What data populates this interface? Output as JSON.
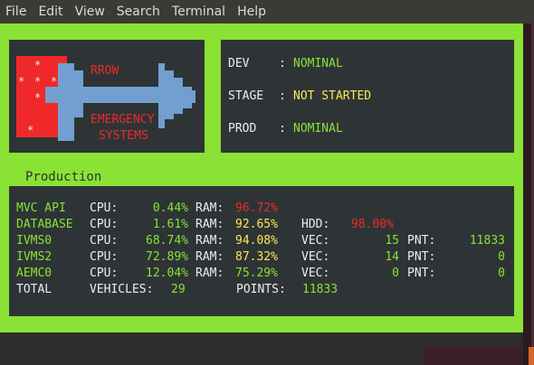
{
  "menu": [
    "File",
    "Edit",
    "View",
    "Search",
    "Terminal",
    "Help"
  ],
  "logo": {
    "line1": "RROW",
    "line2": "EMERGENCY",
    "line3": "SYSTEMS",
    "star": "*"
  },
  "status": [
    {
      "env": "DEV",
      "value": "NOMINAL",
      "color": "#8ae234"
    },
    {
      "env": "STAGE",
      "value": "NOT STARTED",
      "color": "#fce94f"
    },
    {
      "env": "PROD",
      "value": "NOMINAL",
      "color": "#8ae234"
    }
  ],
  "section_title": "Production",
  "rows": [
    {
      "name": "MVC API",
      "cpu_label": "CPU:",
      "cpu": "0.44%",
      "ram_label": "RAM:",
      "ram": "96.72%",
      "ram_color": "red"
    },
    {
      "name": "DATABASE",
      "cpu_label": "CPU:",
      "cpu": "1.61%",
      "ram_label": "RAM:",
      "ram": "92.65%",
      "ram_color": "yellow",
      "extra_label": "HDD:",
      "extra": "98.00%"
    },
    {
      "name": "IVMS0",
      "cpu_label": "CPU:",
      "cpu": "68.74%",
      "ram_label": "RAM:",
      "ram": "94.08%",
      "ram_color": "yellow",
      "vec_label": "VEC:",
      "vec": "15",
      "pnt_label": "PNT:",
      "pnt": "11833"
    },
    {
      "name": "IVMS2",
      "cpu_label": "CPU:",
      "cpu": "72.89%",
      "ram_label": "RAM:",
      "ram": "87.32%",
      "ram_color": "yellow",
      "vec_label": "VEC:",
      "vec": "14",
      "pnt_label": "PNT:",
      "pnt": "0"
    },
    {
      "name": "AEMC0",
      "cpu_label": "CPU:",
      "cpu": "12.04%",
      "ram_label": "RAM:",
      "ram": "75.29%",
      "ram_color": "green",
      "vec_label": "VEC:",
      "vec": "0",
      "pnt_label": "PNT:",
      "pnt": "0"
    }
  ],
  "total": {
    "label": "TOTAL",
    "vehicles_label": "VEHICLES:",
    "vehicles": "29",
    "points_label": "POINTS:",
    "points": "11833"
  },
  "colors": {
    "accent_green": "#8ae234",
    "panel": "#2e3436",
    "warn_yellow": "#fce94f",
    "alert_red": "#ef2929",
    "logo_blue": "#729fcf"
  }
}
